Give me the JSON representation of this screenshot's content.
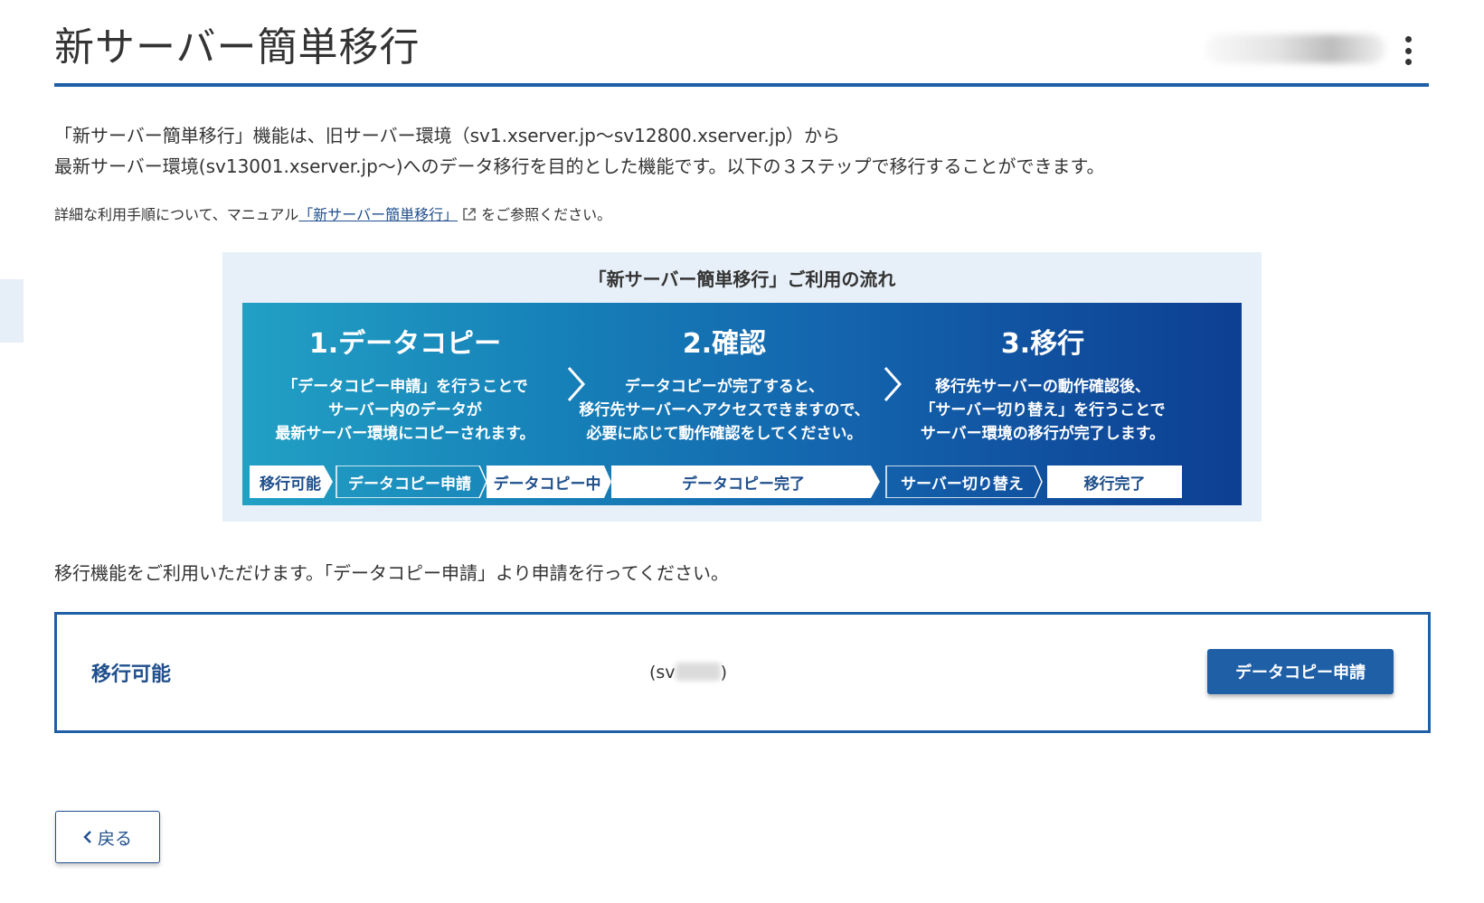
{
  "header": {
    "title": "新サーバー簡単移行"
  },
  "intro": {
    "line1": "「新サーバー簡単移行」機能は、旧サーバー環境（sv1.xserver.jp～sv12800.xserver.jp）から",
    "line2": "最新サーバー環境(sv13001.xserver.jp～)へのデータ移行を目的とした機能です。以下の３ステップで移行することができます。"
  },
  "manual_note": {
    "before": "詳細な利用手順について、マニュアル",
    "link": "「新サーバー簡単移行」",
    "after": "をご参照ください。"
  },
  "flow": {
    "title": "「新サーバー簡単移行」ご利用の流れ",
    "steps": [
      {
        "title": "1.データコピー",
        "lines": [
          "「データコピー申請」を行うことで",
          "サーバー内のデータが",
          "最新サーバー環境にコピーされます。"
        ]
      },
      {
        "title": "2.確認",
        "lines": [
          "データコピーが完了すると、",
          "移行先サーバーへアクセスできますので、",
          "必要に応じて動作確認をしてください。"
        ]
      },
      {
        "title": "3.移行",
        "lines": [
          "移行先サーバーの動作確認後、",
          "「サーバー切り替え」を行うことで",
          "サーバー環境の移行が完了します。"
        ]
      }
    ],
    "statuses": [
      "移行可能",
      "データコピー申請",
      "データコピー中",
      "データコピー完了",
      "サーバー切り替え",
      "移行完了"
    ]
  },
  "notice": "移行機能をご利用いただけます。「データコピー申請」より申請を行ってください。",
  "status_card": {
    "label": "移行可能",
    "server_prefix": "(sv",
    "server_suffix": ")",
    "button": "データコピー申請"
  },
  "back_button": "戻る"
}
